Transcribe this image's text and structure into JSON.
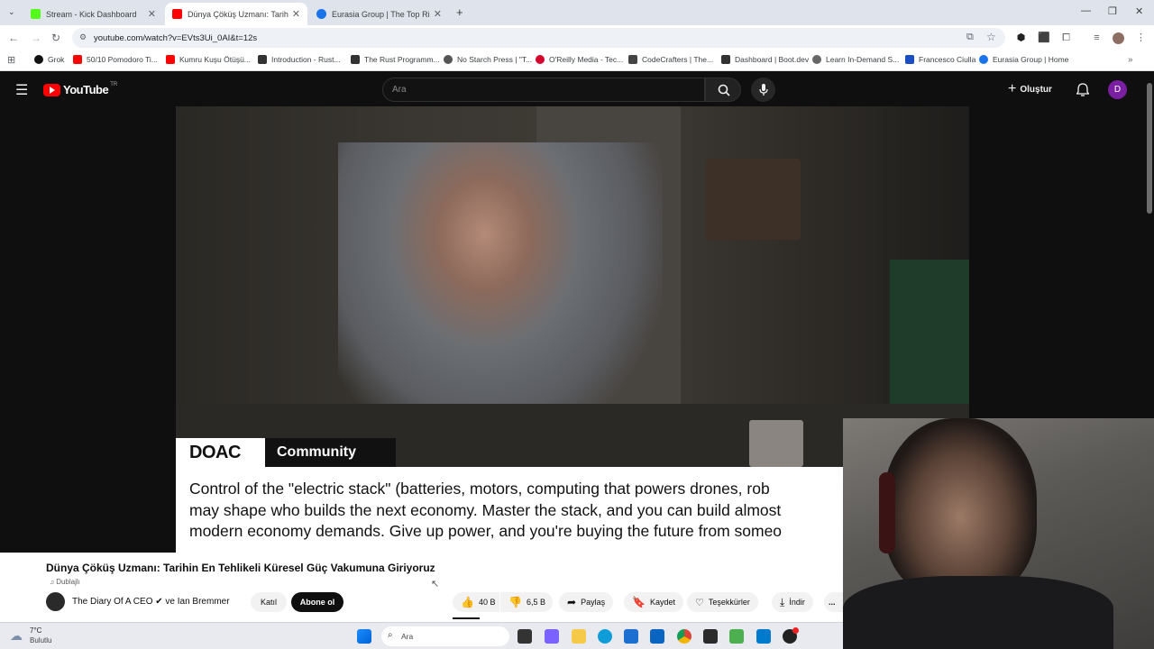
{
  "browser": {
    "tabs": [
      {
        "label": "Stream - Kick Dashboard",
        "favicon_color": "#53fc18"
      },
      {
        "label": "Dünya Çöküş Uzmanı: Tarihin En...",
        "favicon_color": "#ff0000"
      },
      {
        "label": "Eurasia Group | The Top Risks o...",
        "favicon_color": "#1a73e8"
      }
    ],
    "address": "youtube.com/watch?v=EVts3Ui_0AI&t=12s",
    "bookmarks": [
      {
        "label": "Grok",
        "color": "#111111"
      },
      {
        "label": "50/10 Pomodoro Ti...",
        "color": "#ff0000"
      },
      {
        "label": "Kumru Kuşu Ötüşü...",
        "color": "#ff0000"
      },
      {
        "label": "Introduction - Rust...",
        "color": "#333333"
      },
      {
        "label": "The Rust Programm...",
        "color": "#333333"
      },
      {
        "label": "No Starch Press | \"T...",
        "color": "#555555"
      },
      {
        "label": "O'Reilly Media - Tec...",
        "color": "#d3002d"
      },
      {
        "label": "CodeCrafters | The...",
        "color": "#444444"
      },
      {
        "label": "Dashboard | Boot.dev",
        "color": "#333333"
      },
      {
        "label": "Learn In-Demand S...",
        "color": "#666666"
      },
      {
        "label": "Francesco Ciulla",
        "color": "#1a4dbf"
      },
      {
        "label": "Eurasia Group | Home",
        "color": "#1a73e8"
      }
    ]
  },
  "youtube": {
    "logo": "YouTube",
    "region": "TR",
    "search_placeholder": "Ara",
    "create_label": "Oluştur",
    "avatar_letter": "D"
  },
  "video": {
    "overlay_brand": "DOAC",
    "overlay_label": "Community Notes",
    "overlay_text": "Control of the \"electric stack\" (batteries, motors, computing that powers drones, rob\nmay shape who builds the next economy. Master the stack, and you can build almost\nmodern economy demands. Give up power, and you're buying the future from someo",
    "title": "Dünya Çöküş Uzmanı: Tarihin En Tehlikeli Küresel Güç Vakumuna Giriyoruz",
    "dubbed_label": "Dublajlı",
    "channel": "The Diary Of A CEO ✔ ve Ian Bremmer",
    "join_label": "Katıl",
    "subscribe_label": "Abone ol",
    "likes": "40 B",
    "dislikes": "6,5 B",
    "share_label": "Paylaş",
    "save_label": "Kaydet",
    "thanks_label": "Teşekkürler",
    "download_label": "İndir",
    "more_label": "..."
  },
  "taskbar": {
    "temperature": "7°C",
    "weather": "Bulutlu",
    "search_placeholder": "Ara"
  }
}
